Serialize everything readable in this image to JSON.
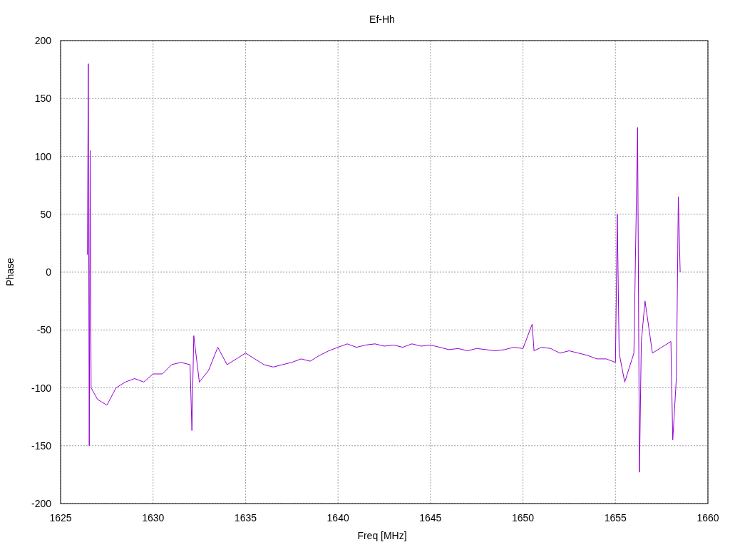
{
  "chart_data": {
    "type": "line",
    "grid": true,
    "title": "Ef-Hh",
    "xlabel": "Freq [MHz]",
    "ylabel": "Phase",
    "xlim": [
      1625,
      1660
    ],
    "ylim": [
      -200,
      200
    ],
    "xticks": [
      1625,
      1630,
      1635,
      1640,
      1645,
      1650,
      1655,
      1660
    ],
    "yticks": [
      -200,
      -150,
      -100,
      -50,
      0,
      50,
      100,
      150,
      200
    ],
    "x": [
      1626.45,
      1626.5,
      1626.55,
      1626.6,
      1626.65,
      1627,
      1627.5,
      1628,
      1628.5,
      1629,
      1629.5,
      1630,
      1630.5,
      1631,
      1631.5,
      1632,
      1632.1,
      1632.2,
      1632.5,
      1633,
      1633.5,
      1634,
      1634.5,
      1635,
      1635.5,
      1636,
      1636.5,
      1637,
      1637.5,
      1638,
      1638.5,
      1639,
      1639.5,
      1640,
      1640.5,
      1641,
      1641.5,
      1642,
      1642.5,
      1643,
      1643.5,
      1644,
      1644.5,
      1645,
      1645.5,
      1646,
      1646.5,
      1647,
      1647.5,
      1648,
      1648.5,
      1649,
      1649.5,
      1650,
      1650.5,
      1650.6,
      1651,
      1651.5,
      1652,
      1652.5,
      1653,
      1653.5,
      1654,
      1654.5,
      1655,
      1655.1,
      1655.2,
      1655.5,
      1656,
      1656.2,
      1656.3,
      1656.4,
      1656.6,
      1657,
      1657.5,
      1658,
      1658.1,
      1658.3,
      1658.4,
      1658.5
    ],
    "series": [
      {
        "color": "#9400d3",
        "values": [
          15,
          180,
          -150,
          105,
          -100,
          -110,
          -115,
          -100,
          -95,
          -92,
          -95,
          -88,
          -88,
          -80,
          -78,
          -80,
          -137,
          -55,
          -95,
          -85,
          -65,
          -80,
          -75,
          -70,
          -75,
          -80,
          -82,
          -80,
          -78,
          -75,
          -77,
          -72,
          -68,
          -65,
          -62,
          -65,
          -63,
          -62,
          -64,
          -63,
          -65,
          -62,
          -64,
          -63,
          -65,
          -67,
          -66,
          -68,
          -66,
          -67,
          -68,
          -67,
          -65,
          -66,
          -45,
          -68,
          -65,
          -66,
          -70,
          -68,
          -70,
          -72,
          -75,
          -75,
          -78,
          50,
          -70,
          -95,
          -70,
          125,
          -173,
          -60,
          -25,
          -70,
          -65,
          -60,
          -145,
          -90,
          65,
          0
        ]
      }
    ]
  }
}
